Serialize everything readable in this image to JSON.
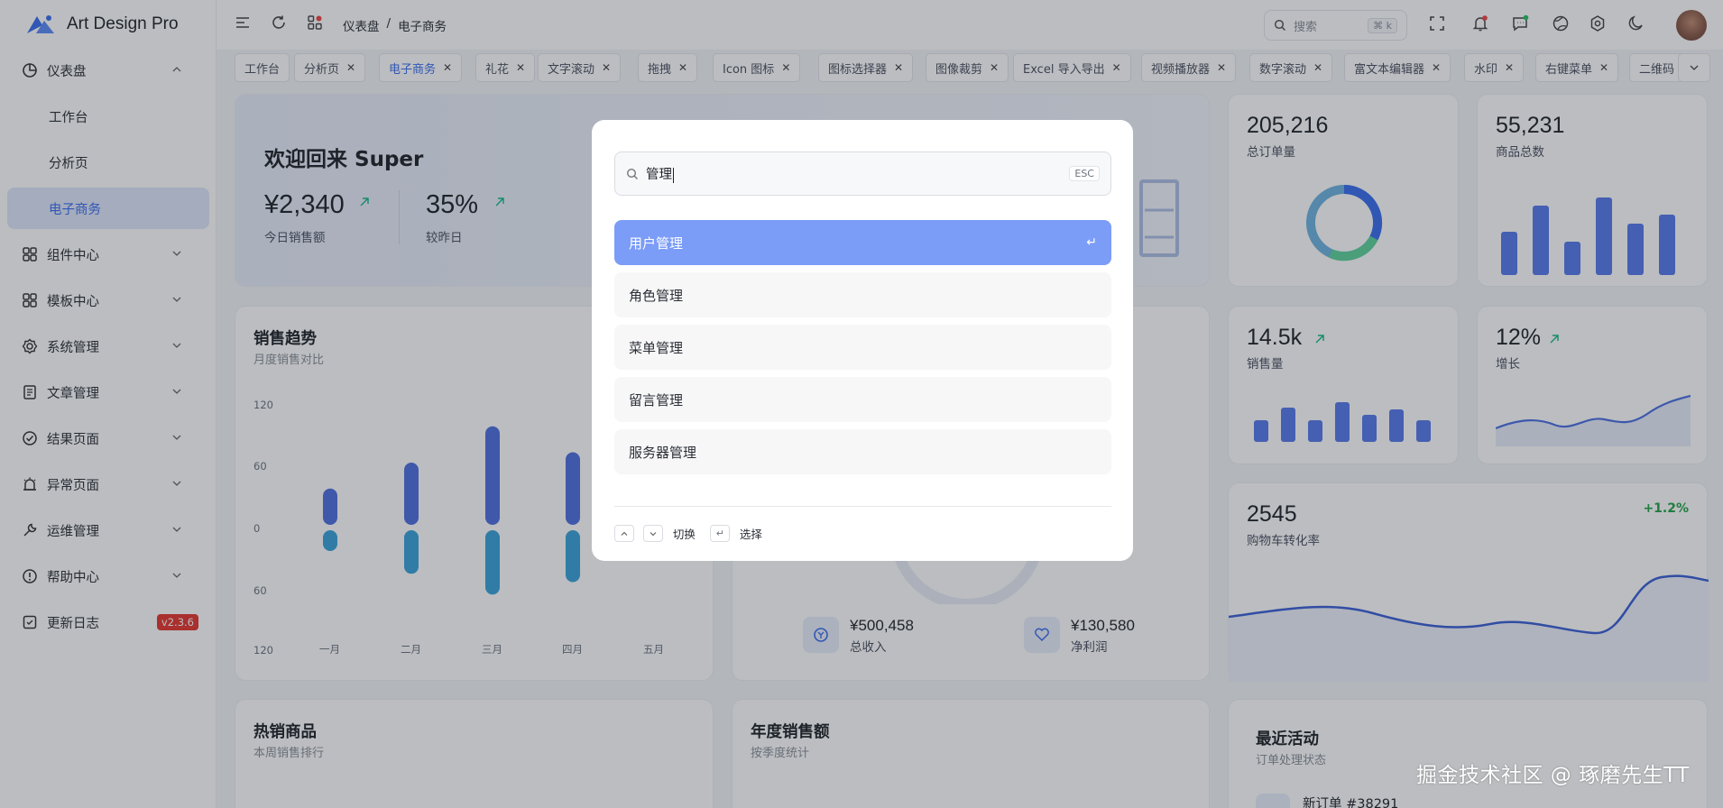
{
  "app": {
    "title": "Art Design Pro"
  },
  "sidebar": {
    "items": [
      {
        "label": "仪表盘",
        "icon": "dashboard-icon"
      },
      {
        "label": "组件中心",
        "icon": "grid-icon"
      },
      {
        "label": "模板中心",
        "icon": "grid-icon"
      },
      {
        "label": "系统管理",
        "icon": "gear-icon"
      },
      {
        "label": "文章管理",
        "icon": "article-icon"
      },
      {
        "label": "结果页面",
        "icon": "check-circle-icon"
      },
      {
        "label": "异常页面",
        "icon": "alarm-icon"
      },
      {
        "label": "运维管理",
        "icon": "wrench-icon"
      },
      {
        "label": "帮助中心",
        "icon": "info-icon"
      },
      {
        "label": "更新日志",
        "icon": "log-icon"
      }
    ],
    "sub": [
      "工作台",
      "分析页",
      "电子商务"
    ],
    "version": "v2.3.6"
  },
  "header": {
    "crumbs": [
      "仪表盘",
      "/",
      "电子商务"
    ],
    "search_placeholder": "搜索",
    "search_kbd": "⌘ k"
  },
  "tabs": [
    "工作台",
    "分析页",
    "电子商务",
    "礼花",
    "文字滚动",
    "拖拽",
    "Icon 图标",
    "图标选择器",
    "图像裁剪",
    "Excel 导入导出",
    "视频播放器",
    "数字滚动",
    "富文本编辑器",
    "水印",
    "右键菜单",
    "二维码"
  ],
  "welcome": {
    "title": "欢迎回来 Super",
    "amount": "¥2,340",
    "amount_label": "今日销售额",
    "percent": "35%",
    "percent_label": "较昨日"
  },
  "stats": [
    {
      "value": "205,216",
      "label": "总订单量"
    },
    {
      "value": "55,231",
      "label": "商品总数"
    },
    {
      "value": "14.5k",
      "label": "销售量"
    },
    {
      "value": "12%",
      "label": "增长"
    },
    {
      "value": "2545",
      "label": "购物车转化率",
      "change": "+1.2%"
    }
  ],
  "sales": {
    "title": "销售趋势",
    "subtitle": "月度销售对比",
    "yticks": [
      "120",
      "60",
      "0",
      "60",
      "120"
    ],
    "months": [
      "一月",
      "二月",
      "三月",
      "四月",
      "五月"
    ]
  },
  "chart_data": {
    "type": "bar",
    "title": "销售趋势",
    "categories": [
      "一月",
      "二月",
      "三月",
      "四月",
      "五月"
    ],
    "series": [
      {
        "values": [
          35,
          60,
          95,
          70,
          null
        ]
      },
      {
        "values": [
          -20,
          -42,
          -62,
          -50,
          null
        ]
      }
    ],
    "ylim": [
      -120,
      120
    ]
  },
  "revenue": {
    "total": "¥500,458",
    "total_label": "总收入",
    "profit": "¥130,580",
    "profit_label": "净利润"
  },
  "bottom": [
    {
      "title": "热销商品",
      "subtitle": "本周销售排行"
    },
    {
      "title": "年度销售额",
      "subtitle": "按季度统计"
    },
    {
      "title": "最近活动",
      "subtitle": "订单处理状态",
      "item": "新订单 #38291"
    }
  ],
  "modal": {
    "query": "管理",
    "esc": "ESC",
    "results": [
      "用户管理",
      "角色管理",
      "菜单管理",
      "留言管理",
      "服务器管理"
    ],
    "enter_glyph": "↵",
    "footer": {
      "switch": "切换",
      "select": "选择"
    }
  },
  "watermark": "掘金技术社区 @ 琢磨先生TT",
  "colors": {
    "accent": "#3a6df0",
    "selected": "#7b9cf7",
    "badge": "#e5362f",
    "up": "#10b981"
  }
}
